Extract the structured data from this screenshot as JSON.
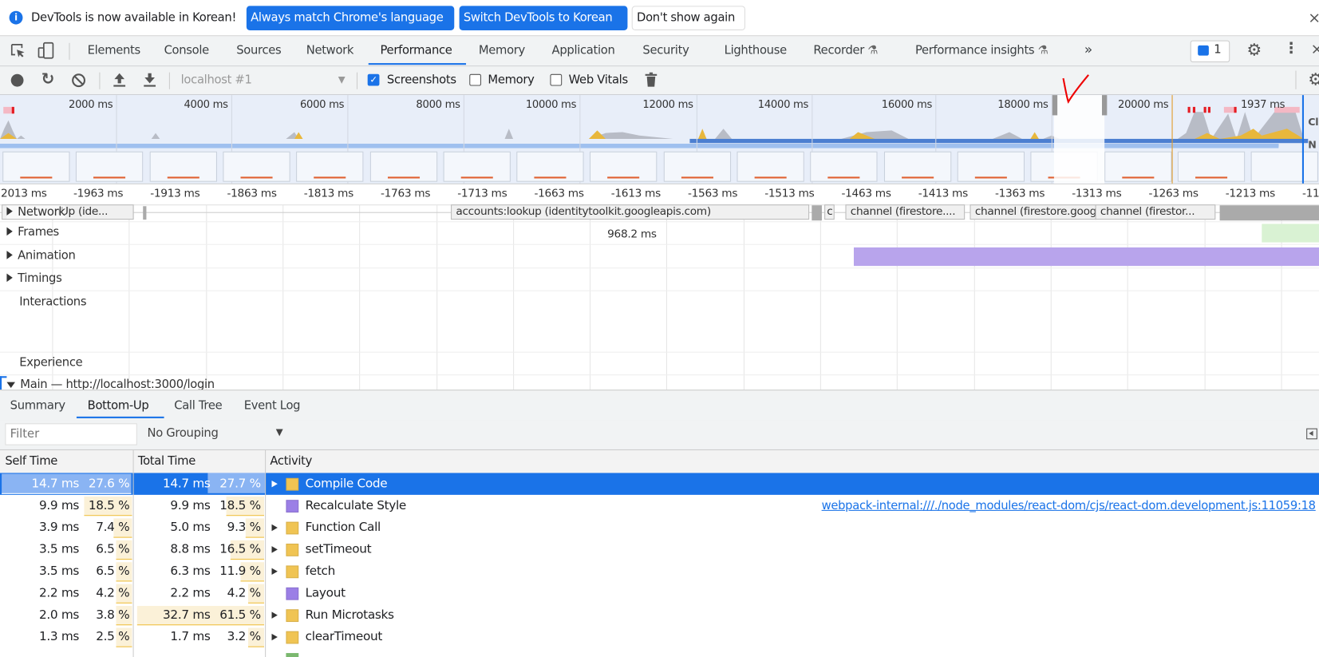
{
  "infobar": {
    "message": "DevTools is now available in Korean!",
    "btn_match": "Always match Chrome's language",
    "btn_switch": "Switch DevTools to Korean",
    "btn_dismiss": "Don't show again",
    "close": "×"
  },
  "tabs": {
    "items": [
      "Elements",
      "Console",
      "Sources",
      "Network",
      "Performance",
      "Memory",
      "Application",
      "Security",
      "Lighthouse",
      "Recorder",
      "Performance insights"
    ],
    "active": "Performance",
    "more": "»",
    "issues_count": "1"
  },
  "toolbar": {
    "profile_select": "localhost #1",
    "screenshots": "Screenshots",
    "memory": "Memory",
    "web_vitals": "Web Vitals",
    "screenshots_checked": true,
    "memory_checked": false,
    "web_vitals_checked": false
  },
  "overview": {
    "ticks": [
      "2000 ms",
      "4000 ms",
      "6000 ms",
      "8000 ms",
      "10000 ms",
      "12000 ms",
      "14000 ms",
      "16000 ms",
      "18000 ms",
      "20000 ms"
    ],
    "selection_duration": "1937 ms",
    "side_labels": [
      "Cl",
      "N"
    ]
  },
  "flame_ruler": [
    "2013 ms",
    "-1963 ms",
    "-1913 ms",
    "-1863 ms",
    "-1813 ms",
    "-1763 ms",
    "-1713 ms",
    "-1663 ms",
    "-1613 ms",
    "-1563 ms",
    "-1513 ms",
    "-1463 ms",
    "-1413 ms",
    "-1363 ms",
    "-1313 ms",
    "-1263 ms",
    "-1213 ms",
    "-11"
  ],
  "tracks": {
    "network": "Network",
    "network_req1": "nUp (ide...",
    "network_req2": "accounts:lookup (identitytoolkit.googleapis.com)",
    "network_req3": "c",
    "network_req4": "channel (firestore....",
    "network_req5": "channel (firestore.goog",
    "network_req6": "channel (firestor...",
    "frames": "Frames",
    "frame_duration": "968.2 ms",
    "animation": "Animation",
    "timings": "Timings",
    "interactions": "Interactions",
    "experience": "Experience",
    "main": "Main — http://localhost:3000/login"
  },
  "bottom_tabs": {
    "items": [
      "Summary",
      "Bottom-Up",
      "Call Tree",
      "Event Log"
    ],
    "active": "Bottom-Up"
  },
  "filter": {
    "placeholder": "Filter",
    "grouping": "No Grouping"
  },
  "table": {
    "headers": [
      "Self Time",
      "Total Time",
      "Activity"
    ],
    "rows": [
      {
        "self": "14.7 ms",
        "self_pct": "27.6 %",
        "self_frac": 0.276,
        "total": "14.7 ms",
        "total_pct": "27.7 %",
        "total_frac": 0.277,
        "activity": "Compile Code",
        "color": "#f0c453",
        "expandable": true,
        "selected": true,
        "link": ""
      },
      {
        "self": "9.9 ms",
        "self_pct": "18.5 %",
        "self_frac": 0.185,
        "total": "9.9 ms",
        "total_pct": "18.5 %",
        "total_frac": 0.185,
        "activity": "Recalculate Style",
        "color": "#9b7fe6",
        "expandable": false,
        "link": "webpack-internal:///./node_modules/react-dom/cjs/react-dom.development.js:11059:18"
      },
      {
        "self": "3.9 ms",
        "self_pct": "7.4 %",
        "self_frac": 0.074,
        "total": "5.0 ms",
        "total_pct": "9.3 %",
        "total_frac": 0.093,
        "activity": "Function Call",
        "color": "#f0c453",
        "expandable": true,
        "link": ""
      },
      {
        "self": "3.5 ms",
        "self_pct": "6.5 %",
        "self_frac": 0.065,
        "total": "8.8 ms",
        "total_pct": "16.5 %",
        "total_frac": 0.165,
        "activity": "setTimeout",
        "color": "#f0c453",
        "expandable": true,
        "link": ""
      },
      {
        "self": "3.5 ms",
        "self_pct": "6.5 %",
        "self_frac": 0.065,
        "total": "6.3 ms",
        "total_pct": "11.9 %",
        "total_frac": 0.119,
        "activity": "fetch",
        "color": "#f0c453",
        "expandable": true,
        "link": ""
      },
      {
        "self": "2.2 ms",
        "self_pct": "4.2 %",
        "self_frac": 0.042,
        "total": "2.2 ms",
        "total_pct": "4.2 %",
        "total_frac": 0.042,
        "activity": "Layout",
        "color": "#9b7fe6",
        "expandable": false,
        "link": ""
      },
      {
        "self": "2.0 ms",
        "self_pct": "3.8 %",
        "self_frac": 0.038,
        "total": "32.7 ms",
        "total_pct": "61.5 %",
        "total_frac": 0.615,
        "activity": "Run Microtasks",
        "color": "#f0c453",
        "expandable": true,
        "link": ""
      },
      {
        "self": "1.3 ms",
        "self_pct": "2.5 %",
        "self_frac": 0.025,
        "total": "1.7 ms",
        "total_pct": "3.2 %",
        "total_frac": 0.032,
        "activity": "clearTimeout",
        "color": "#f0c453",
        "expandable": true,
        "link": ""
      }
    ]
  }
}
